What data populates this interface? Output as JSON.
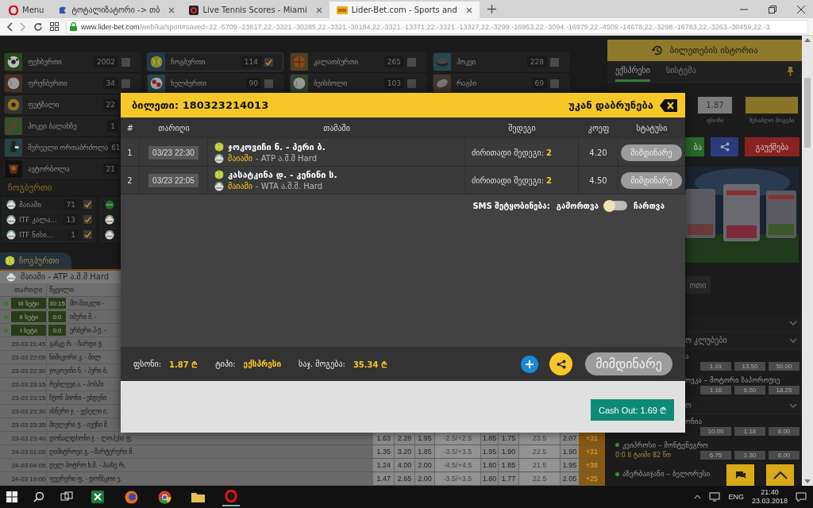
{
  "browser": {
    "tabs": [
      {
        "kind": "menu",
        "label": "Menu",
        "selected": false
      },
      {
        "kind": "page",
        "label": "ტოტალიზატორი -> თბ",
        "selected": false
      },
      {
        "kind": "page",
        "label": "Live Tennis Scores - Miami",
        "selected": false
      },
      {
        "kind": "page",
        "label": "Lider-Bet.com - Sports and",
        "selected": true
      }
    ],
    "url_host": "www.lider-bet.com",
    "url_path": "/web/ka/sport#saved=22.-5709.-23817,22.-3321.-30285,22.-3321.-30184,22.-3321.-13371,22.-3321.-13327,22.-3299.-16953,22.-3094.-16979,22.-4509.-14678,22.-3298.-16783,22.-3263.-30459,22.-3"
  },
  "sports": {
    "columns": [
      [
        {
          "name": "ფეხბურთი",
          "count": "2002",
          "checked": false
        },
        {
          "name": "ფრენბურთი",
          "count": "34",
          "checked": false
        },
        {
          "name": "ფუტზალი",
          "count": "22"
        },
        {
          "name": "ჰოკეი ბალახზე",
          "count": "1"
        },
        {
          "name": "შერეული ორთაბრძოლა",
          "count": "61"
        },
        {
          "name": "ავტორბოლა",
          "count": "21"
        }
      ],
      [
        {
          "name": "ჩოგბურთი",
          "count": "114",
          "checked": true
        },
        {
          "name": "ხელბურთი",
          "count": "90",
          "checked": false
        }
      ],
      [
        {
          "name": "კალათბურთი",
          "count": "265",
          "checked": false
        },
        {
          "name": "ბეისბოლი",
          "count": "103",
          "checked": false
        }
      ],
      [
        {
          "name": "ჰოკეი",
          "count": "228",
          "checked": false
        },
        {
          "name": "რაგბი",
          "count": "69",
          "checked": false
        }
      ]
    ]
  },
  "tennis_filter": {
    "title": "ჩოგბურთი",
    "items": [
      {
        "name": "მაიამი",
        "count": "71",
        "checked": true
      },
      {
        "name": "ITF კალა...",
        "count": "13",
        "checked": true
      },
      {
        "name": "ITF ნისი...",
        "count": "1",
        "checked": true
      }
    ]
  },
  "sport_tab": {
    "label": "ჩოგბურთი"
  },
  "tournament": {
    "title": "მაიამი - ATP ა.შ.შ Hard",
    "columns": [
      "თარიღი",
      "წყვილი"
    ],
    "rows": [
      {
        "kind": "live",
        "period": "III სეტი",
        "score": "30:15",
        "pair": "მო მაიკლი -"
      },
      {
        "kind": "live",
        "period": "II სეტი",
        "score": "0:0",
        "pair": "იმერი მ. -"
      },
      {
        "kind": "live",
        "period": "I სეტი",
        "score": "0:0",
        "pair": "ერბერი პ-ჟ. -"
      },
      {
        "kind": "scheduled",
        "date": "23-03 21:45",
        "pair": "გასკე რ. - ჩარდი ჟ."
      },
      {
        "kind": "scheduled",
        "date": "23-03 22:05",
        "pair": "ნიშიკორი კ. - მილ"
      },
      {
        "kind": "scheduled",
        "date": "23-03 22:30",
        "pair": "ჯოკოვიჩი ნ. - პერი ბ."
      },
      {
        "kind": "scheduled",
        "date": "23-03 23:15",
        "pair": "რუბლევი ა. - პოსპი"
      },
      {
        "kind": "scheduled",
        "date": "23-03 23:15",
        "pair": "ჩჟონ ჰიონი - ებდენი"
      },
      {
        "kind": "scheduled",
        "date": "23-03 23:30",
        "pair": "ისნერი ჯ. - ვესელი ი."
      },
      {
        "kind": "scheduled",
        "date": "23-03 23:35",
        "pair": "მიულერი ჟ. - იუჟნი მ."
      },
      {
        "kind": "scheduled",
        "date": "23-03 23:40",
        "pair": "დონალდსონი ჯ. - ლოპესი ფ.",
        "odds": [
          "1.63",
          "2.28",
          "1.95",
          "-2.5/+2.5",
          "1.85",
          "1.75",
          "23.5",
          "2.07"
        ],
        "more": "+31"
      },
      {
        "kind": "scheduled",
        "date": "24-03 01:05",
        "pair": "დიმიტროვი გ. - მარტერერი მ.",
        "odds": [
          "1.35",
          "3.20",
          "1.85",
          "-3.5/+3.5",
          "1.95",
          "1.90",
          "22.5",
          "1.90"
        ],
        "more": "+31"
      },
      {
        "kind": "scheduled",
        "date": "24-03 04:05",
        "pair": "დელ პოტრო ხ.მ. - ჰაასე რ.",
        "odds": [
          "1.24",
          "4.00",
          "2.00",
          "-4.5/+4.5",
          "1.80",
          "1.85",
          "21.5",
          "1.95"
        ],
        "more": "+38"
      },
      {
        "kind": "scheduled",
        "date": "24-03 19:00",
        "pair": "ფეერერი ფ. - დონსკოი ე.",
        "odds": [
          "1.47",
          "2.65",
          "2.00",
          "-3.5/+3.5",
          "1.80",
          "1.77",
          "22.5",
          "2.05"
        ],
        "more": "+25"
      }
    ]
  },
  "ticket": {
    "title": "ბილეთი: 180323214013",
    "back": "უკან დაბრუნება",
    "columns": [
      "#",
      "თარიღი",
      "თამაში",
      "შედეგი",
      "კოეფ",
      "სტატუსი"
    ],
    "rows": [
      {
        "index": "1",
        "date": "03/23 22:30",
        "match": "ჯოკოვიჩი ნ. - პერი ბ.",
        "tournament": "მაიამი",
        "event": "- ATP ა.შ.შ Hard",
        "result_label": "ძირითადი შედეგი:",
        "result_value": "2",
        "odds": "4.20",
        "status": "მიმდინარე"
      },
      {
        "index": "2",
        "date": "03/23 22:05",
        "match": "კასატკინა დ. - კენინი ს.",
        "tournament": "მაიამი",
        "event": "- WTA ა.შ.შ. Hard",
        "result_label": "ძირითადი შედეგი:",
        "result_value": "2",
        "odds": "4.50",
        "status": "მიმდინარე"
      }
    ],
    "sms": {
      "label": "SMS შეტყობინება:",
      "off_label": "გამორთვა",
      "on_label": "ჩართვა",
      "on": false
    },
    "summary": [
      {
        "label": "ფსონი:",
        "value": "1.87 ₾"
      },
      {
        "label": "ტიპი:",
        "value": "ექსპრესი"
      },
      {
        "label": "საჯ. მოგება:",
        "value": "35.34 ₾"
      }
    ],
    "status_button": "მიმდინარე",
    "cash_out": "Cash Out: 1.69 ₾"
  },
  "history": {
    "title": "ბილეთების ისტორია",
    "tabs": [
      {
        "label": "ექსპრესი",
        "selected": true
      },
      {
        "label": "სისტემა",
        "selected": false
      }
    ],
    "stake": "1.87",
    "stake_label": "ფსონი",
    "win_label": "შესაძლო მოგება",
    "buttons": [
      {
        "kind": "place",
        "label": "ბა"
      },
      {
        "kind": "share"
      },
      {
        "kind": "cancel",
        "label": "გაუქმება"
      }
    ],
    "sport_tab": "ოთი",
    "rows": [
      {
        "kind": "group"
      },
      {
        "kind": "group",
        "label": "ო კლუბები"
      },
      {
        "kind": "match",
        "label": "ა",
        "odds": [
          "1.01",
          "13.50",
          "50.00"
        ]
      },
      {
        "kind": "match",
        "label": "ოვკა – მოტორი ზაპოროჟიე",
        "odds": [
          "1.16",
          "6.50",
          "18.25"
        ]
      },
      {
        "kind": "group",
        "label": "ო"
      },
      {
        "kind": "match",
        "label": "ონია",
        "odds": [
          "10.00",
          "1.18",
          "8.00"
        ]
      },
      {
        "kind": "match",
        "label": "კვიპროსი – მონტენეგრო",
        "live": true,
        "info": "0:0 II ტაიმი 82 წთ",
        "odds": [
          "6.75",
          "1.30",
          "6.00"
        ]
      },
      {
        "kind": "match",
        "label": "აზერბაიჯანი – ბელორუსი",
        "live": true
      }
    ]
  },
  "taskbar": {
    "language": "ENG",
    "time": "21:40",
    "date": "23.03.2018"
  }
}
